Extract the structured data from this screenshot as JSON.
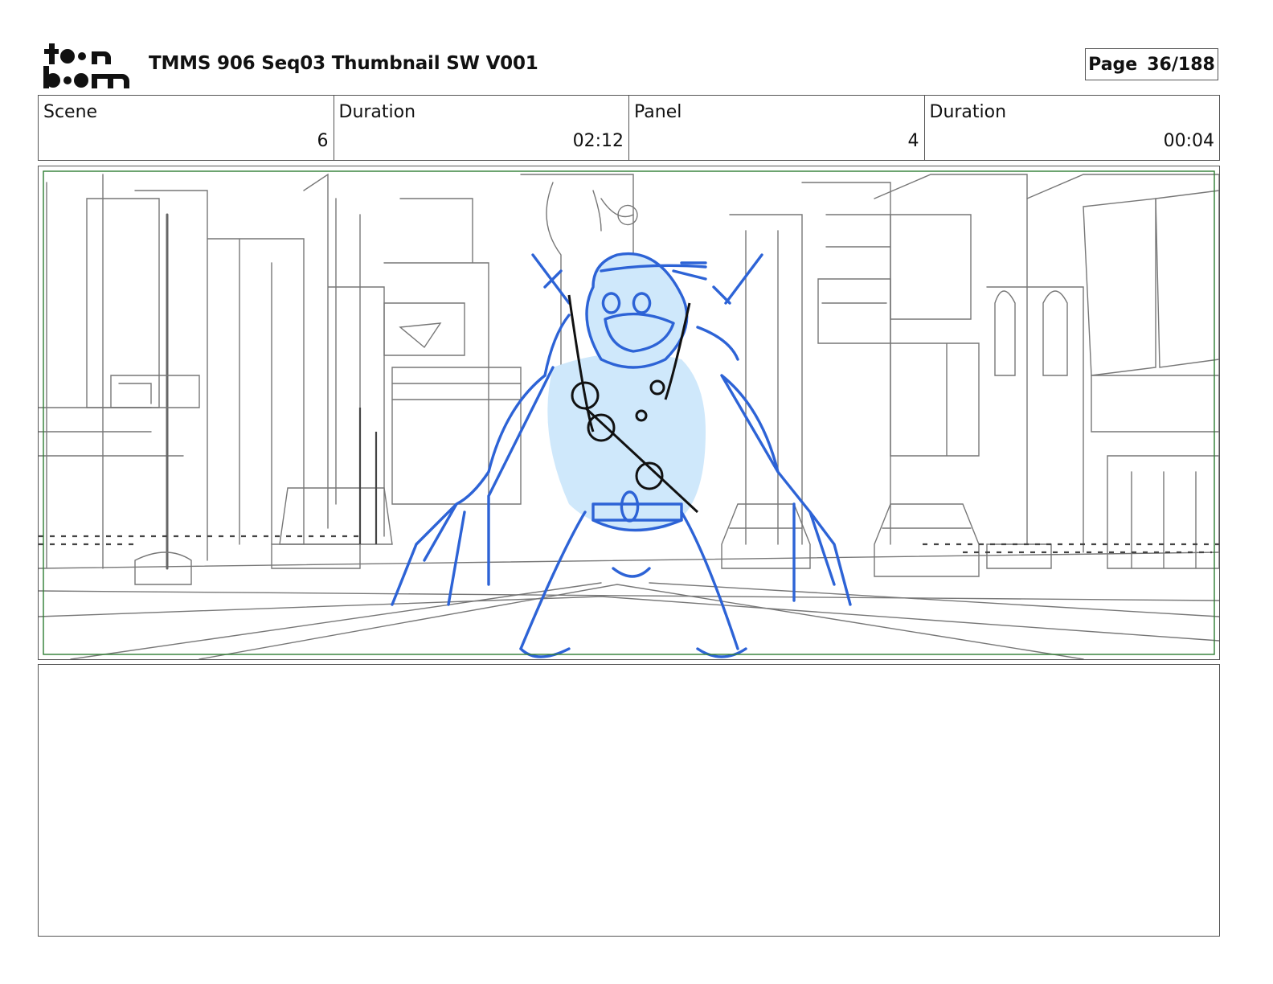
{
  "header": {
    "logo_lines": [
      "toon",
      "boom"
    ],
    "title": "TMMS 906 Seq03 Thumbnail SW V001",
    "page_label": "Page",
    "page_value": "36/188"
  },
  "info": [
    {
      "label": "Scene",
      "value": "6"
    },
    {
      "label": "Duration",
      "value": "02:12"
    },
    {
      "label": "Panel",
      "value": "4"
    },
    {
      "label": "Duration",
      "value": "00:04"
    }
  ],
  "panel_image": {
    "description_icon": "storyboard-sketch",
    "line_color": "#555555",
    "character_color": "#2d63d6",
    "character_fill": "#cfe8fb",
    "frame_color": "#2e7d32"
  },
  "notes": {
    "text": ""
  }
}
